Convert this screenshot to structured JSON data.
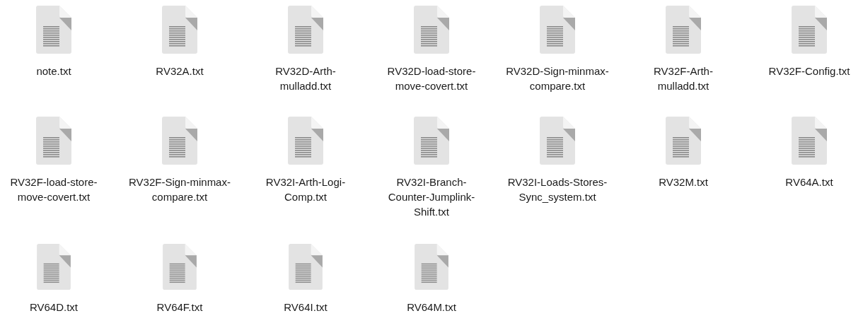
{
  "files": [
    {
      "name": "note.txt",
      "kind": "text"
    },
    {
      "name": "RV32A.txt",
      "kind": "text"
    },
    {
      "name": "RV32D-Arth-mulladd.txt",
      "kind": "text"
    },
    {
      "name": "RV32D-load-store-move-covert.txt",
      "kind": "text"
    },
    {
      "name": "RV32D-Sign-minmax-compare.txt",
      "kind": "text"
    },
    {
      "name": "RV32F-Arth-mulladd.txt",
      "kind": "text"
    },
    {
      "name": "RV32F-Config.txt",
      "kind": "text"
    },
    {
      "name": "RV32F-load-store-move-covert.txt",
      "kind": "text"
    },
    {
      "name": "RV32F-Sign-minmax-compare.txt",
      "kind": "text"
    },
    {
      "name": "RV32I-Arth-Logi-Comp.txt",
      "kind": "text"
    },
    {
      "name": "RV32I-Branch-Counter-Jumplink-Shift.txt",
      "kind": "text"
    },
    {
      "name": "RV32I-Loads-Stores-Sync_system.txt",
      "kind": "text"
    },
    {
      "name": "RV32M.txt",
      "kind": "text"
    },
    {
      "name": "RV64A.txt",
      "kind": "text"
    },
    {
      "name": "RV64D.txt",
      "kind": "text"
    },
    {
      "name": "RV64F.txt",
      "kind": "text"
    },
    {
      "name": "RV64I.txt",
      "kind": "text"
    },
    {
      "name": "RV64M.txt",
      "kind": "text"
    }
  ]
}
